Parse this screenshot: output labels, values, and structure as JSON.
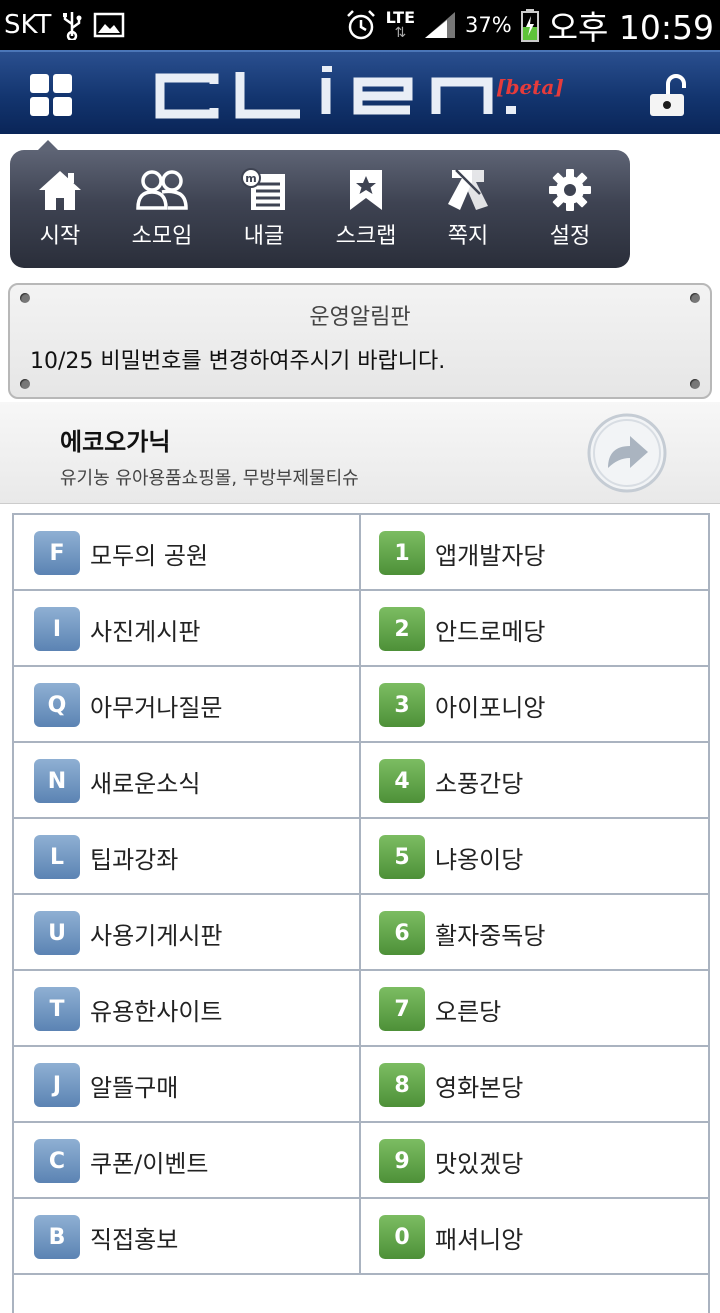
{
  "status_bar": {
    "carrier": "SKT",
    "battery": "37%",
    "network": "LTE",
    "time": "오후 10:59"
  },
  "header": {
    "logo_text": "CLIEN.",
    "beta": "[beta]"
  },
  "menu": [
    {
      "label": "시작",
      "icon": "home-icon"
    },
    {
      "label": "소모임",
      "icon": "group-icon"
    },
    {
      "label": "내글",
      "icon": "my-posts-icon"
    },
    {
      "label": "스크랩",
      "icon": "bookmark-icon"
    },
    {
      "label": "쪽지",
      "icon": "message-icon"
    },
    {
      "label": "설정",
      "icon": "gear-icon"
    }
  ],
  "notice": {
    "title": "운영알림판",
    "message": "10/25 비밀번호를 변경하여주시기 바랍니다."
  },
  "ad": {
    "title": "에코오가닉",
    "subtitle": "유기농 유아용품쇼핑몰, 무방부제물티슈"
  },
  "boards": [
    {
      "left": {
        "key": "F",
        "name": "모두의 공원"
      },
      "right": {
        "key": "1",
        "name": "앱개발자당"
      }
    },
    {
      "left": {
        "key": "I",
        "name": "사진게시판"
      },
      "right": {
        "key": "2",
        "name": "안드로메당"
      }
    },
    {
      "left": {
        "key": "Q",
        "name": "아무거나질문"
      },
      "right": {
        "key": "3",
        "name": "아이포니앙"
      }
    },
    {
      "left": {
        "key": "N",
        "name": "새로운소식"
      },
      "right": {
        "key": "4",
        "name": "소풍간당"
      }
    },
    {
      "left": {
        "key": "L",
        "name": "팁과강좌"
      },
      "right": {
        "key": "5",
        "name": "냐옹이당"
      }
    },
    {
      "left": {
        "key": "U",
        "name": "사용기게시판"
      },
      "right": {
        "key": "6",
        "name": "활자중독당"
      }
    },
    {
      "left": {
        "key": "T",
        "name": "유용한사이트"
      },
      "right": {
        "key": "7",
        "name": "오른당"
      }
    },
    {
      "left": {
        "key": "J",
        "name": "알뜰구매"
      },
      "right": {
        "key": "8",
        "name": "영화본당"
      }
    },
    {
      "left": {
        "key": "C",
        "name": "쿠폰/이벤트"
      },
      "right": {
        "key": "9",
        "name": "맛있겠당"
      }
    },
    {
      "left": {
        "key": "B",
        "name": "직접홍보"
      },
      "right": {
        "key": "0",
        "name": "패셔니앙"
      }
    }
  ],
  "colors": {
    "header_blue": "#13356f",
    "badge_blue": "#5b83b3",
    "badge_green": "#4d9038",
    "menu_dark": "#3e4352"
  }
}
